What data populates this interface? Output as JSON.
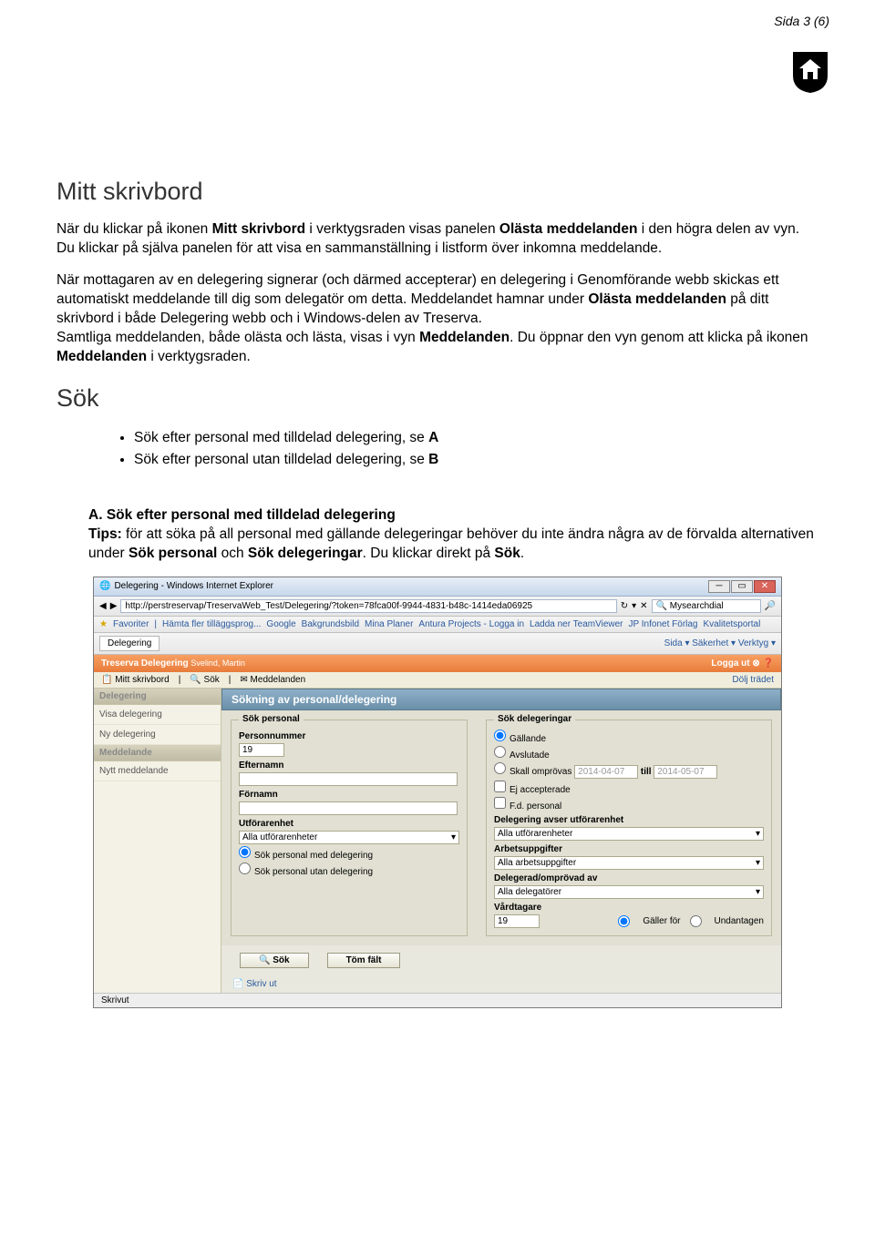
{
  "page_number": "Sida 3 (6)",
  "h1": "Mitt skrivbord",
  "p1_a": "När du klickar på ikonen ",
  "p1_b": "Mitt skrivbord",
  "p1_c": " i verktygsraden visas panelen ",
  "p1_d": "Olästa meddelanden",
  "p1_e": " i den högra delen av vyn. Du klickar på själva panelen för att visa en sammanställning i listform över inkomna meddelande.",
  "p2_a": "När mottagaren av en delegering signerar (och därmed accepterar) en delegering i Genomförande webb skickas ett automatiskt meddelande till dig som delegatör om detta. Meddelandet hamnar under ",
  "p2_b": "Olästa meddelanden",
  "p2_c": " på ditt skrivbord i både Delegering webb och i Windows-delen av Treserva.",
  "p3_a": "Samtliga meddelanden, både olästa och lästa, visas i vyn ",
  "p3_b": "Meddelanden",
  "p3_c": ". Du öppnar den vyn genom att klicka på ikonen ",
  "p3_d": "Meddelanden",
  "p3_e": " i verktygsraden.",
  "h2": "Sök",
  "bullets": [
    {
      "a": "Sök efter personal med tilldelad delegering, se ",
      "b": "A"
    },
    {
      "a": "Sök efter personal utan tilldelad delegering, se ",
      "b": "B"
    }
  ],
  "sectA": {
    "num": "A.",
    "head": "Sök efter personal med tilldelad delegering",
    "tips_label": "Tips:",
    "body_a": " för att söka på all personal med gällande delegeringar behöver du inte ändra några av de förvalda alternativen under ",
    "body_b": "Sök personal",
    "body_c": " och ",
    "body_d": "Sök delegeringar",
    "body_e": ". Du klickar direkt på ",
    "body_f": "Sök",
    "body_g": "."
  },
  "ss": {
    "title": "Delegering - Windows Internet Explorer",
    "url": "http://perstreservap/TreservaWeb_Test/Delegering/?token=78fca00f-9944-4831-b48c-1414eda06925",
    "search_provider": "Mysearchdial",
    "fav_label": "Favoriter",
    "fav_items": [
      "Hämta fler tilläggsprog...",
      "Google",
      "Bakgrundsbild",
      "Mina Planer",
      "Antura Projects - Logga in",
      "Ladda ner TeamViewer",
      "JP Infonet Förlag",
      "Kvalitetsportal"
    ],
    "tab": "Delegering",
    "toolbar_right": "Sida ▾   Säkerhet ▾   Verktyg ▾",
    "orange_title": "Treserva Delegering",
    "orange_user": "Svelind, Martin",
    "orange_logout": "Logga ut",
    "beige_items": [
      "Mitt skrivbord",
      "Sök",
      "Meddelanden"
    ],
    "beige_right": "Dölj trädet",
    "side_hdr1": "Delegering",
    "side_items1": [
      "Visa delegering",
      "Ny delegering"
    ],
    "side_hdr2": "Meddelande",
    "side_items2": [
      "Nytt meddelande"
    ],
    "panel_title": "Sökning av personal/delegering",
    "fs1_legend": "Sök personal",
    "lbl_pnr": "Personnummer",
    "val_pnr": "19",
    "lbl_efternamn": "Efternamn",
    "lbl_fornamn": "Förnamn",
    "lbl_utforarenhet": "Utförarenhet",
    "sel_utforarenhet": "Alla utförarenheter",
    "radio_med": "Sök personal med delegering",
    "radio_utan": "Sök personal utan delegering",
    "fs2_legend": "Sök delegeringar",
    "r_gallande": "Gällande",
    "r_avslutade": "Avslutade",
    "r_skall": "Skall omprövas",
    "date1": "2014-04-07",
    "till": "till",
    "date2": "2014-05-07",
    "chk_ej": "Ej accepterade",
    "chk_fd": "F.d. personal",
    "lbl_del_avser": "Delegering avser utförarenhet",
    "sel_del_avser": "Alla utförarenheter",
    "lbl_arbets": "Arbetsuppgifter",
    "sel_arbets": "Alla arbetsuppgifter",
    "lbl_delegerad": "Delegerad/omprövad av",
    "sel_delegerad": "Alla delegatörer",
    "lbl_vardtagare": "Vårdtagare",
    "val_vardtagare": "19",
    "r_galler": "Gäller för",
    "r_undantagen": "Undantagen",
    "btn_sok": "Sök",
    "btn_tom": "Töm fält",
    "lnk_skrivut": "Skriv ut",
    "status": "Skrivut"
  }
}
